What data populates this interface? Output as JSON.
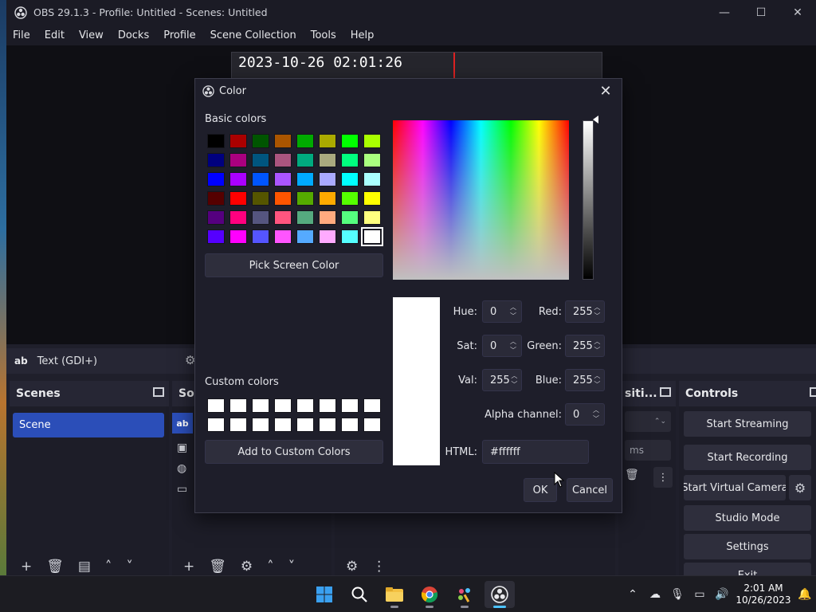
{
  "window": {
    "title": "OBS 29.1.3 - Profile: Untitled - Scenes: Untitled",
    "minimize": "—",
    "maximize": "☐",
    "close": "✕"
  },
  "menu": [
    "File",
    "Edit",
    "View",
    "Docks",
    "Profile",
    "Scene Collection",
    "Tools",
    "Help"
  ],
  "preview": {
    "timestamp": "2023-10-26 02:01:26"
  },
  "source_bar": {
    "icon_text": "ab",
    "label": "Text (GDI+)"
  },
  "docks": {
    "scenes": {
      "title": "Scenes",
      "items": [
        "Scene"
      ]
    },
    "sources": {
      "title": "So",
      "icon_text": "ab"
    },
    "transitions": {
      "title": "siti...",
      "duration_unit": "ms"
    },
    "controls": {
      "title": "Controls",
      "buttons": [
        "Start Streaming",
        "Start Recording",
        "Start Virtual Camera",
        "Studio Mode",
        "Settings",
        "Exit"
      ]
    }
  },
  "dialog": {
    "title": "Color",
    "basic_colors_label": "Basic colors",
    "basic_colors": [
      "#000000",
      "#aa0000",
      "#005500",
      "#aa5500",
      "#00aa00",
      "#aaaa00",
      "#00ff00",
      "#aaff00",
      "#00007f",
      "#aa007f",
      "#00557f",
      "#aa557f",
      "#00aa7f",
      "#aaaa7f",
      "#00ff7f",
      "#aaff7f",
      "#0000ff",
      "#aa00ff",
      "#0055ff",
      "#aa55ff",
      "#00aaff",
      "#aaaaff",
      "#00ffff",
      "#aaffff",
      "#550000",
      "#ff0000",
      "#555500",
      "#ff5500",
      "#55aa00",
      "#ffaa00",
      "#55ff00",
      "#ffff00",
      "#55007f",
      "#ff007f",
      "#55557f",
      "#ff557f",
      "#55aa7f",
      "#ffaa7f",
      "#55ff7f",
      "#ffff7f",
      "#5500ff",
      "#ff00ff",
      "#5555ff",
      "#ff55ff",
      "#55aaff",
      "#ffaaff",
      "#55ffff",
      "#ffffff"
    ],
    "selected_basic_index": 47,
    "pick_screen_color": "Pick Screen Color",
    "custom_colors_label": "Custom colors",
    "custom_colors_count": 16,
    "add_custom": "Add to Custom Colors",
    "fields": {
      "hue": {
        "label": "Hue:",
        "value": "0"
      },
      "sat": {
        "label": "Sat:",
        "value": "0"
      },
      "val": {
        "label": "Val:",
        "value": "255"
      },
      "red": {
        "label": "Red:",
        "value": "255"
      },
      "green": {
        "label": "Green:",
        "value": "255"
      },
      "blue": {
        "label": "Blue:",
        "value": "255"
      },
      "alpha": {
        "label": "Alpha channel:",
        "value": "0"
      },
      "html": {
        "label": "HTML:",
        "value": "#ffffff"
      }
    },
    "current_color": "#ffffff",
    "ok": "OK",
    "cancel": "Cancel"
  },
  "taskbar": {
    "time": "2:01 AM",
    "date": "10/26/2023"
  },
  "colors": {
    "accent": "#2b4eb8",
    "dialog_bg": "#1e1e2a",
    "button_bg": "#2e2e3c"
  }
}
